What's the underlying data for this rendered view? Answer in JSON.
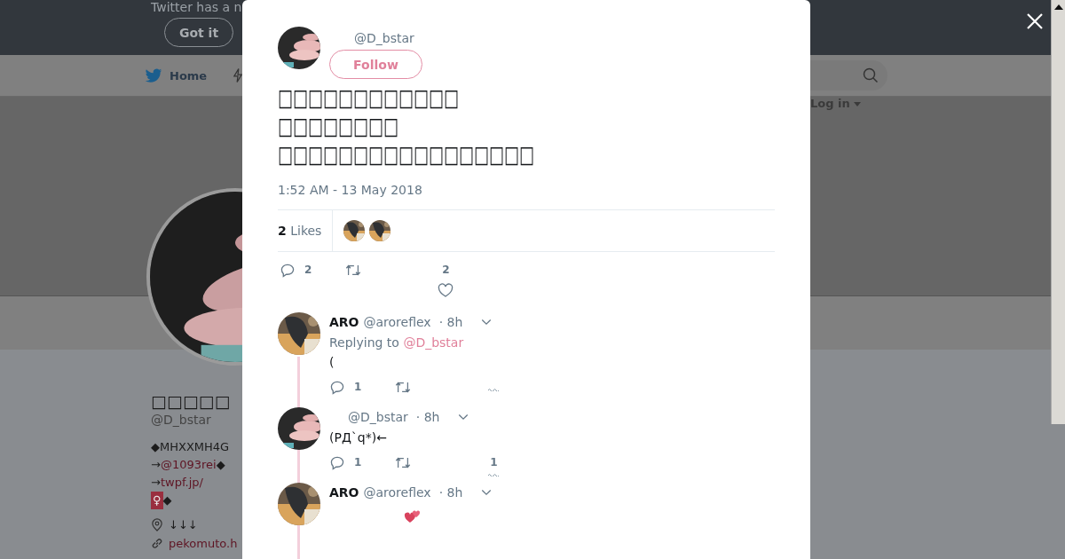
{
  "banner": {
    "text": "Twitter has a n",
    "button": "Got it"
  },
  "nav": {
    "items": [
      {
        "label": "Home"
      }
    ],
    "login": "Log in"
  },
  "profile": {
    "name": "□□□□□",
    "handle": "@D_bstar",
    "bio": [
      [
        {
          "text": "◆MHXXMH4G",
          "link": false
        }
      ],
      [
        {
          "text": "→",
          "link": false
        },
        {
          "text": "@1093rei",
          "link": true
        },
        {
          "text": "◆",
          "link": false
        }
      ],
      [
        {
          "text": "→",
          "link": false
        },
        {
          "text": "twpf.jp/",
          "link": true
        }
      ],
      [
        {
          "text": "♀",
          "kind": "badge"
        },
        {
          "text": "◆",
          "link": false
        }
      ]
    ],
    "location": "↓↓↓",
    "website": "pekomuto.h"
  },
  "tweet": {
    "handle": "@D_bstar",
    "follow": "Follow",
    "text_lines": [
      "□□□□□□□□□□□□",
      "□□□□□□□□",
      "□□□□□□□□□□□□□□□□□"
    ],
    "timestamp": "1:52 AM - 13 May 2018",
    "likes_count": "2",
    "likes_label": "Likes",
    "likers": [
      {
        "kind": "picture"
      },
      {
        "kind": "picture"
      }
    ],
    "reply_count": "2",
    "like_count": "2"
  },
  "replies": [
    {
      "kind": "text",
      "name": "ARO",
      "handle": "@aroreflex",
      "time": "· 8h",
      "replying_prefix": "Replying to",
      "replying_handle": "@D_bstar",
      "text": "(",
      "reply_count": "1"
    },
    {
      "kind": "text",
      "handle": "@D_bstar",
      "time": "· 8h",
      "text": "(РД`q*)←",
      "reply_count": "1",
      "like_count": "1"
    },
    {
      "kind": "emoji",
      "name": "ARO",
      "handle": "@aroreflex",
      "time": "· 8h"
    }
  ]
}
